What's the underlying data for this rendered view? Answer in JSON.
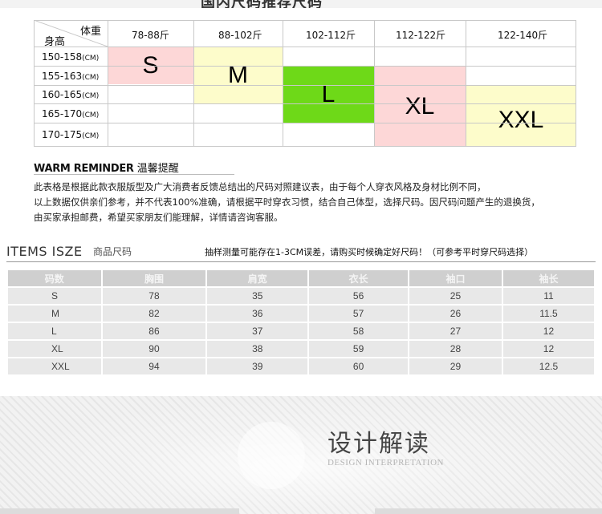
{
  "header": {
    "title_partial": "国内尺码推荐尺码"
  },
  "guide": {
    "corner_weight": "体重",
    "corner_height": "身高",
    "weight_cols": [
      "78-88斤",
      "88-102斤",
      "102-112斤",
      "112-122斤",
      "122-140斤"
    ],
    "height_rows": [
      {
        "range": "150-158",
        "unit": "(CM)"
      },
      {
        "range": "155-163",
        "unit": "(CM)"
      },
      {
        "range": "160-165",
        "unit": "(CM)"
      },
      {
        "range": "165-170",
        "unit": "(CM)"
      },
      {
        "range": "170-175",
        "unit": "(CM)"
      }
    ],
    "sizes": [
      {
        "label": "S",
        "color": "#fdd7d7"
      },
      {
        "label": "M",
        "color": "#fdfccb"
      },
      {
        "label": "L",
        "color": "#6ed918"
      },
      {
        "label": "XL",
        "color": "#fdd7d7"
      },
      {
        "label": "XXL",
        "color": "#fdfccb"
      }
    ]
  },
  "reminder": {
    "title_en": "WARM REMINDER",
    "title_cn": "温馨提醒",
    "lines": [
      "此表格是根据此款衣服版型及广大消费者反馈总结出的尺码对照建议表，由于每个人穿衣风格及身材比例不同，",
      "以上数据仅供亲们参考，并不代表100%准确，请根据平时穿衣习惯，结合自己体型，选择尺码。因尺码问题产生的退换货，",
      "由买家承担邮费，希望买家朋友们能理解，详情请咨询客服。"
    ]
  },
  "items": {
    "title": "ITEMS ISZE",
    "subtitle": "商品尺码",
    "note": "抽样测量可能存在1-3CM误差，请购买时候确定好尺码！（可参考平时穿尺码选择）",
    "headers": [
      "码数",
      "胸围",
      "肩宽",
      "衣长",
      "袖口",
      "袖长"
    ],
    "rows": [
      [
        "S",
        "78",
        "35",
        "56",
        "25",
        "11"
      ],
      [
        "M",
        "82",
        "36",
        "57",
        "26",
        "11.5"
      ],
      [
        "L",
        "86",
        "37",
        "58",
        "27",
        "12"
      ],
      [
        "XL",
        "90",
        "38",
        "59",
        "28",
        "12"
      ],
      [
        "XXL",
        "94",
        "39",
        "60",
        "29",
        "12.5"
      ]
    ]
  },
  "design": {
    "title": "设计解读",
    "subtitle": "DESIGN INTERPRETATION"
  }
}
